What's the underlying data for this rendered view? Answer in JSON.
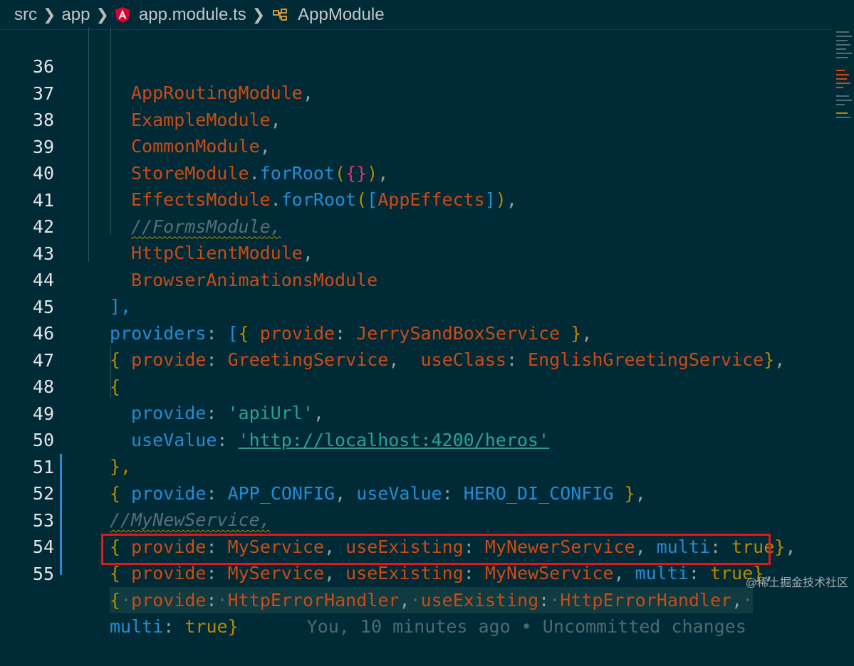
{
  "breadcrumb": {
    "items": [
      "src",
      "app",
      "app.module.ts",
      "AppModule"
    ]
  },
  "lines": [
    {
      "n": "36",
      "t": "AppRoutingModule"
    },
    {
      "n": "37",
      "t": "ExampleModule"
    },
    {
      "n": "38",
      "t": "CommonModule"
    },
    {
      "n": "39",
      "a": "StoreModule",
      "m": "forRoot",
      "r": "({})"
    },
    {
      "n": "40",
      "a": "EffectsModule",
      "m": "forRoot",
      "r": "AppEffects"
    },
    {
      "n": "41",
      "t": "//FormsModule,"
    },
    {
      "n": "42",
      "t": "HttpClientModule"
    },
    {
      "n": "43",
      "t": "BrowserAnimationsModule"
    },
    {
      "n": "44",
      "t": "],"
    },
    {
      "n": "45",
      "k": "providers",
      "p": "provide",
      "v": "JerrySandBoxService"
    },
    {
      "n": "46",
      "p": "provide",
      "v": "GreetingService",
      "p2": "useClass",
      "v2": "EnglishGreetingService"
    },
    {
      "n": "47",
      "t": "{"
    },
    {
      "n": "48",
      "p": "provide",
      "v": "'apiUrl'"
    },
    {
      "n": "49",
      "p": "useValue",
      "v": "'http://localhost:4200/heros'"
    },
    {
      "n": "50",
      "t": "},"
    },
    {
      "n": "51",
      "p": "provide",
      "v": "APP_CONFIG",
      "p2": "useValue",
      "v2": "HERO_DI_CONFIG"
    },
    {
      "n": "52",
      "t": "//MyNewService,"
    },
    {
      "n": "53",
      "p": "provide",
      "v": "MyService",
      "p2": "useExisting",
      "v2": "MyNewerService",
      "p3": "multi",
      "v3": "true"
    },
    {
      "n": "54",
      "p": "provide",
      "v": "MyService",
      "p2": "useExisting",
      "v2": "MyNewService",
      "p3": "multi",
      "v3": "true"
    },
    {
      "n": "55",
      "p": "provide",
      "v": "HttpErrorHandler",
      "p2": "useExisting",
      "v2": "HttpErrorHandler"
    },
    {
      "n": "",
      "p": "multi",
      "v": "true",
      "blame": "You, 10 minutes ago • Uncommitted changes"
    }
  ],
  "watermark": "@稀土掘金技术社区",
  "colors": {
    "background": "#002b36",
    "identifier": "#cb4b16",
    "property": "#268bd2",
    "string": "#2aa198",
    "highlight_box": "#e01818"
  }
}
